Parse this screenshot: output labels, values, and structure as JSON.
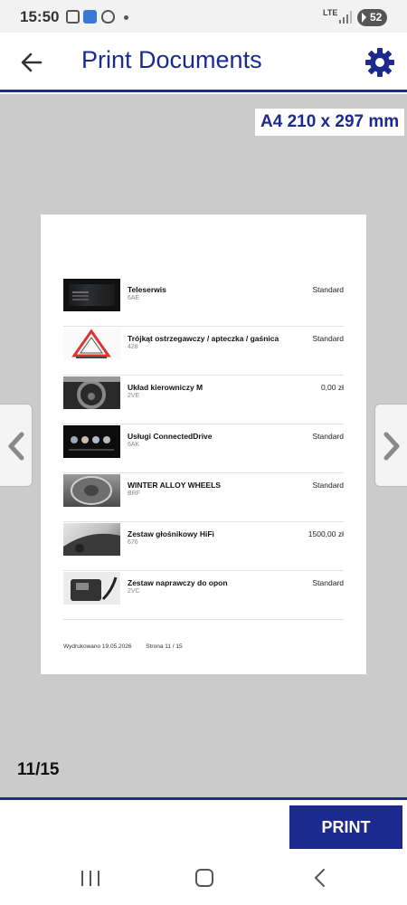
{
  "status_bar": {
    "time": "15:50",
    "network": "LTE",
    "battery": "52"
  },
  "header": {
    "title": "Print Documents",
    "back_icon": "arrow-left-icon",
    "settings_icon": "gear-icon"
  },
  "preview": {
    "paper_size": "A4 210 x 297 mm",
    "page_counter": "11/15",
    "items": [
      {
        "name": "Teleserwis",
        "code": "6AE",
        "status": "Standard",
        "thumb": "screen"
      },
      {
        "name": "Trójkąt ostrzegawczy / apteczka / gaśnica",
        "code": "428",
        "status": "Standard",
        "thumb": "triangle"
      },
      {
        "name": "Układ kierowniczy M",
        "code": "2VE",
        "status": "0,00 zł",
        "thumb": "wheel"
      },
      {
        "name": "Usługi ConnectedDrive",
        "code": "6AK",
        "status": "Standard",
        "thumb": "connected"
      },
      {
        "name": "WINTER ALLOY WHEELS",
        "code": "BRF",
        "status": "Standard",
        "thumb": "alloy"
      },
      {
        "name": "Zestaw głośnikowy HiFi",
        "code": "676",
        "status": "1500,00 zł",
        "thumb": "speaker"
      },
      {
        "name": "Zestaw naprawczy do opon",
        "code": "2VC",
        "status": "Standard",
        "thumb": "repair"
      }
    ],
    "footer": {
      "printed": "Wydrukowano 19.05.2026",
      "page": "Strona 11 / 15"
    }
  },
  "actions": {
    "print_label": "PRINT"
  },
  "colors": {
    "brand": "#1c2a8f",
    "preview_bg": "#cbcbcb"
  }
}
